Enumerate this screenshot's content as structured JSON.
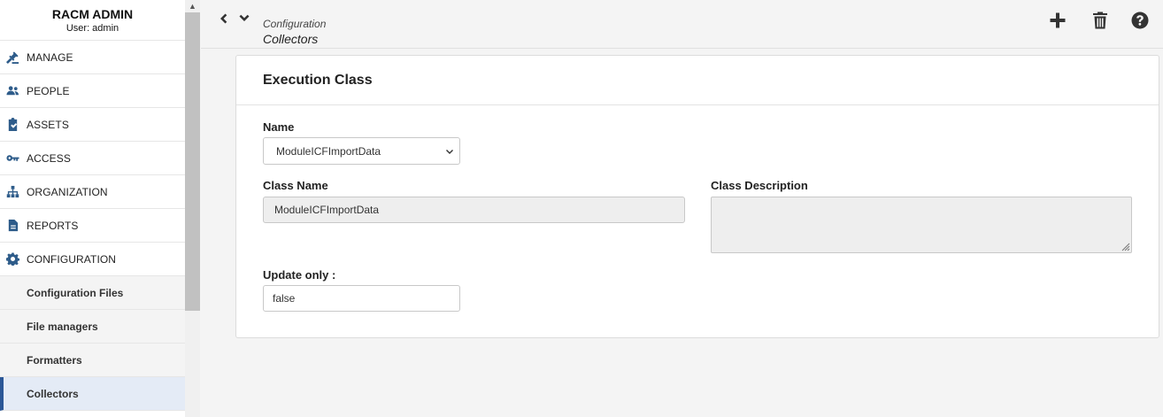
{
  "app": {
    "title": "RACM ADMIN",
    "user_line": "User: admin"
  },
  "sidebar": {
    "items": [
      {
        "label": "MANAGE",
        "icon": "gavel-icon"
      },
      {
        "label": "PEOPLE",
        "icon": "people-icon"
      },
      {
        "label": "ASSETS",
        "icon": "clipboard-check-icon"
      },
      {
        "label": "ACCESS",
        "icon": "key-icon"
      },
      {
        "label": "ORGANIZATION",
        "icon": "sitemap-icon"
      },
      {
        "label": "REPORTS",
        "icon": "document-icon"
      },
      {
        "label": "CONFIGURATION",
        "icon": "gear-icon"
      }
    ],
    "sub_items": [
      {
        "label": "Configuration Files"
      },
      {
        "label": "File managers"
      },
      {
        "label": "Formatters"
      },
      {
        "label": "Collectors"
      }
    ],
    "active_sub_item": "Collectors"
  },
  "breadcrumb": {
    "parent": "Configuration",
    "current": "Collectors"
  },
  "toolbar": {
    "icons": [
      "plus-icon",
      "trash-icon",
      "help-icon"
    ]
  },
  "form": {
    "title": "Execution Class",
    "name_label": "Name",
    "name_value": "ModuleICFImportData",
    "class_name_label": "Class Name",
    "class_name_value": "ModuleICFImportData",
    "class_description_label": "Class Description",
    "class_description_value": "",
    "update_only_label": "Update only :",
    "update_only_value": "false"
  },
  "colors": {
    "accent": "#2b5797",
    "icon_blue": "#2e5c8a",
    "active_bg": "#e4ebf6"
  }
}
